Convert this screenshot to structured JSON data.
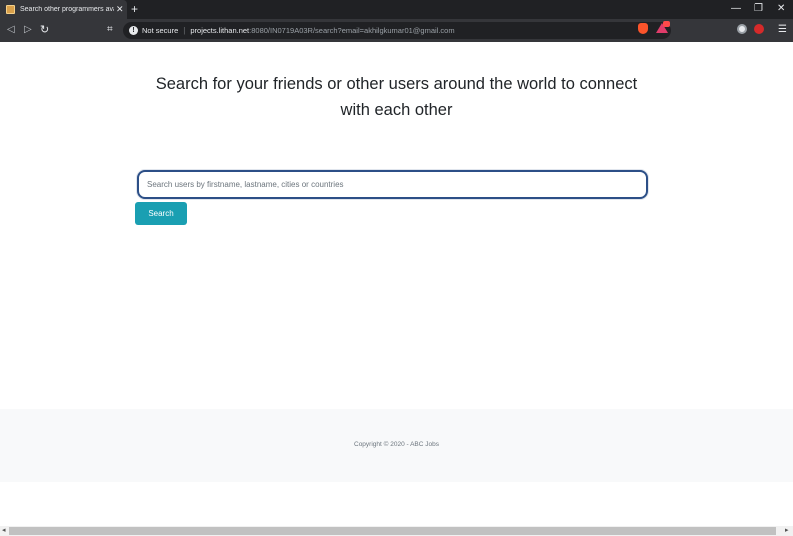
{
  "browser": {
    "tab_title": "Search other programmers availab",
    "tab_close": "✕",
    "new_tab": "+",
    "window_controls": [
      "—",
      "❐",
      "✕"
    ],
    "nav": {
      "back": "◁",
      "forward": "▷",
      "reload": "↻",
      "bookmark": "⌗"
    },
    "security_label": "Not secure",
    "url_host": "projects.lithan.net",
    "url_rest": ":8080/IN0719A03R/search?email=akhilgkumar01@gmail.com",
    "menu": "☰",
    "icons": [
      "info-icon",
      "brave-shield-icon",
      "brave-rewards-icon",
      "extension-icon",
      "extension-icon-red",
      "menu-icon"
    ]
  },
  "main": {
    "heading": "Search for your friends or other users around the world to connect with each other",
    "search": {
      "placeholder": "Search users by firstname, lastname, cities or countries",
      "value": ""
    },
    "search_button": "Search"
  },
  "footer": {
    "copyright": "Copyright © 2020 - ABC Jobs"
  },
  "colors": {
    "accent": "#1a9fb2",
    "input_border": "#2c4f87",
    "footer_bg": "#f8f9fa"
  }
}
